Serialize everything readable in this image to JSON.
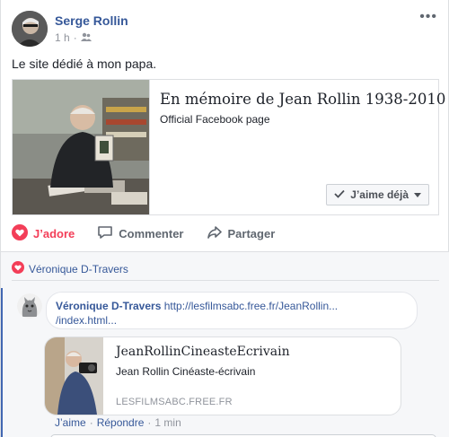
{
  "post": {
    "author": "Serge Rollin",
    "time": "1 h",
    "separator": "·",
    "more_label": "•••",
    "text": "Le site dédié à mon papa."
  },
  "link_card": {
    "title": "En mémoire de Jean Rollin 1938-2010",
    "subtitle": "Official Facebook page",
    "like_button": "J’aime déjà"
  },
  "actions": {
    "love": "J’adore",
    "comment": "Commenter",
    "share": "Partager"
  },
  "comments": {
    "reacted_by": "Véronique D-Travers",
    "items": [
      {
        "author": "Véronique D-Travers",
        "link_line1": "http://lesfilmsabc.free.fr/JeanRollin...",
        "link_line2": "/index.html...",
        "preview": {
          "title": "JeanRollinCineasteEcrivain",
          "subtitle": "Jean Rollin Cinéaste-écrivain",
          "domain": "LESFILMSABC.FREE.FR"
        },
        "like": "J’aime",
        "reply": "Répondre",
        "time": "1 min",
        "dot": "·"
      }
    ]
  },
  "colors": {
    "link_blue": "#365899",
    "love_red": "#f33e58",
    "muted_gray": "#90949c",
    "accent_blue": "#4267b2"
  }
}
